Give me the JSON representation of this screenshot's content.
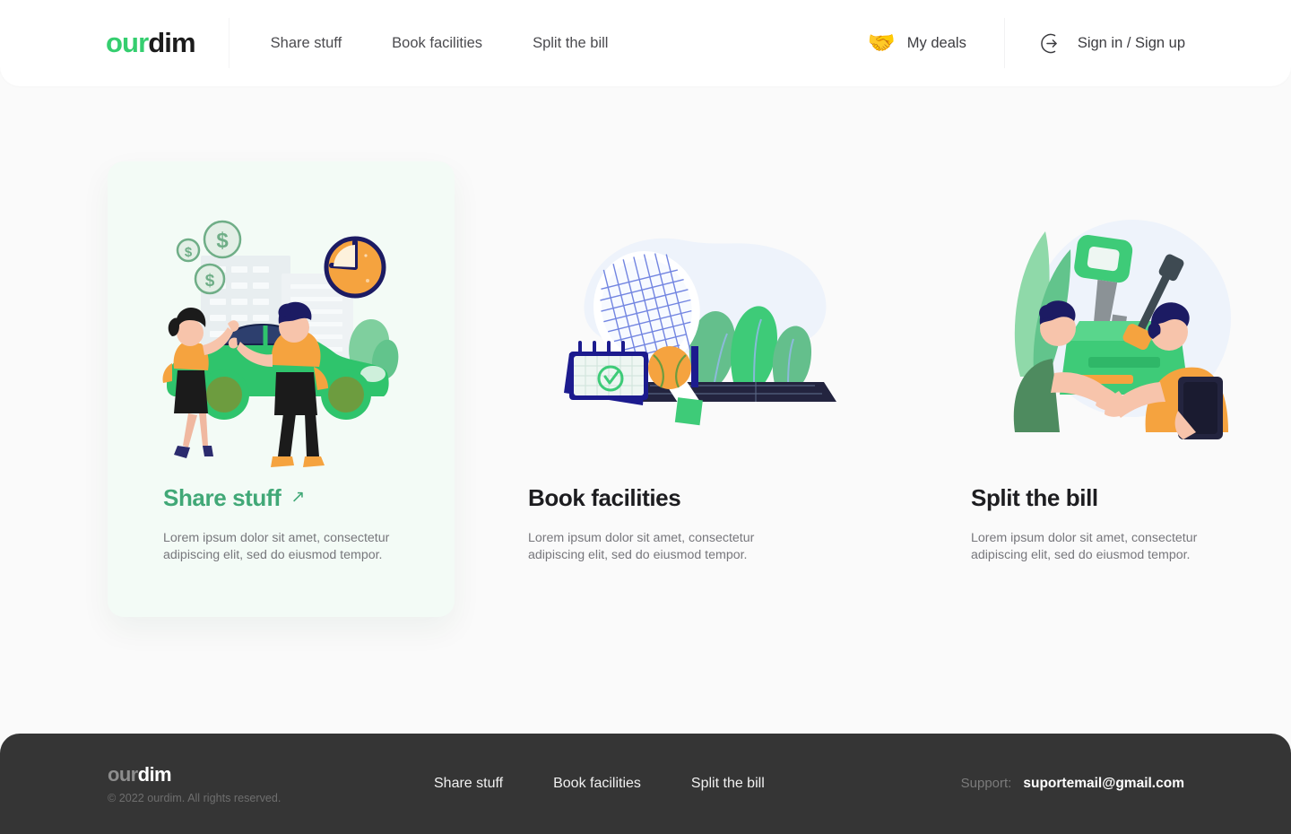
{
  "brand": {
    "name_part1": "our",
    "name_part2": "dim"
  },
  "header": {
    "nav": [
      {
        "label": "Share stuff"
      },
      {
        "label": "Book facilities"
      },
      {
        "label": "Split the bill"
      }
    ],
    "deals": {
      "icon": "handshake-emoji",
      "emoji": "🤝",
      "label": "My deals"
    },
    "signin": {
      "icon": "login-circle-icon",
      "label": "Sign in / Sign up"
    }
  },
  "cards": [
    {
      "id": "share-stuff",
      "title": "Share stuff",
      "description": "Lorem ipsum dolor sit amet, consectetur adipiscing elit, sed do eiusmod tempor.",
      "arrow_icon": "arrow-up-right-icon",
      "arrow_glyph": "↗",
      "active": true,
      "illustration": "car-sharing-illustration"
    },
    {
      "id": "book-facilities",
      "title": "Book facilities",
      "description": "Lorem ipsum dolor sit amet, consectetur adipiscing elit, sed do eiusmod tempor.",
      "active": false,
      "illustration": "tennis-court-calendar-illustration"
    },
    {
      "id": "split-the-bill",
      "title": "Split the bill",
      "description": "Lorem ipsum dolor sit amet, consectetur adipiscing elit, sed do eiusmod tempor.",
      "active": false,
      "illustration": "handshake-key-illustration"
    }
  ],
  "footer": {
    "brand_part1": "our",
    "brand_part2": "dim",
    "copyright": "© 2022 ourdim. All rights reserved.",
    "nav": [
      {
        "label": "Share stuff"
      },
      {
        "label": "Book facilities"
      },
      {
        "label": "Split the bill"
      }
    ],
    "support_label": "Support:",
    "support_email": "suportemail@gmail.com"
  },
  "colors": {
    "brand_green": "#35ce6f",
    "title_green": "#41a877",
    "page_bg": "#fafafa",
    "card_bg": "#f3fbf6",
    "footer_bg": "#353535"
  }
}
